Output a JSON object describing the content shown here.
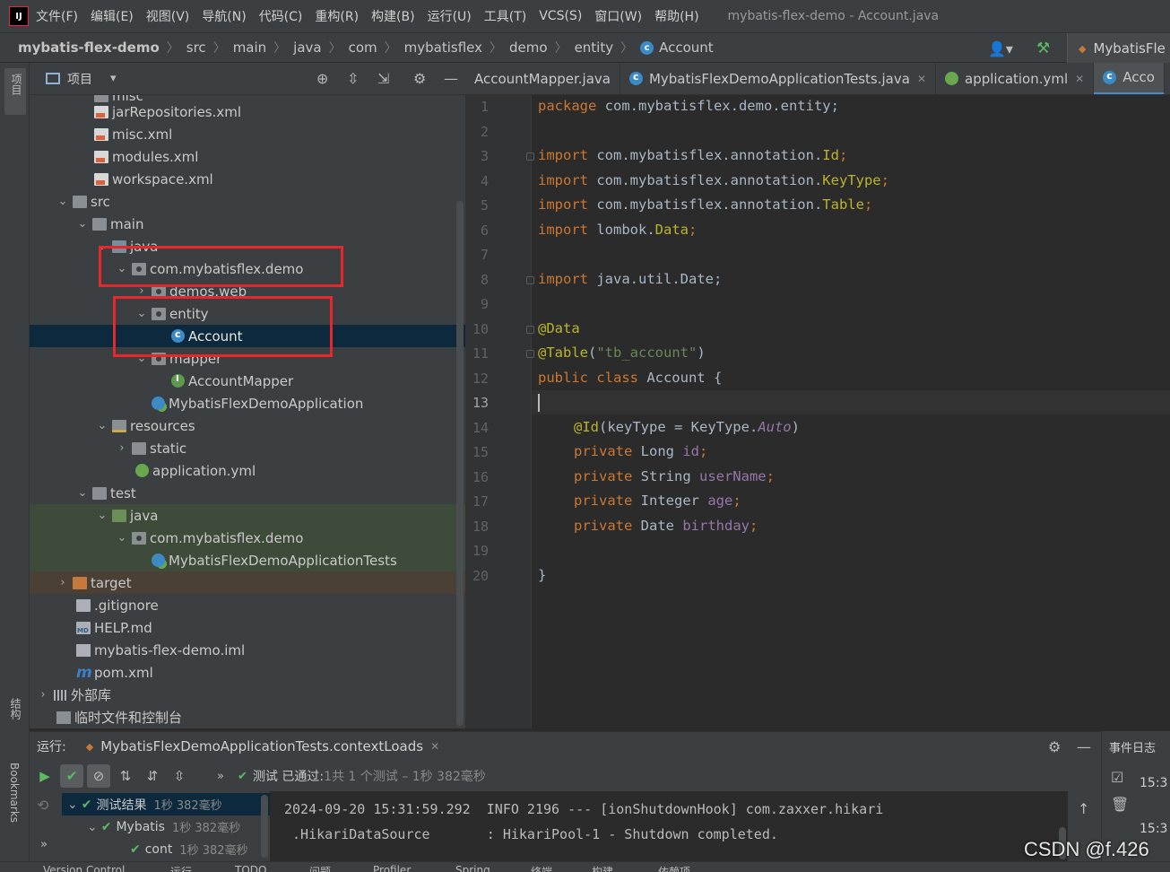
{
  "app": {
    "menu": [
      "文件(F)",
      "编辑(E)",
      "视图(V)",
      "导航(N)",
      "代码(C)",
      "重构(R)",
      "构建(B)",
      "运行(U)",
      "工具(T)",
      "VCS(S)",
      "窗口(W)",
      "帮助(H)"
    ],
    "window_title": "mybatis-flex-demo - Account.java",
    "logo": "IJ"
  },
  "breadcrumb": [
    "mybatis-flex-demo",
    "src",
    "main",
    "java",
    "com",
    "mybatisflex",
    "demo",
    "entity",
    "Account"
  ],
  "run_config": "MybatisFle",
  "project_panel": {
    "title": "项目",
    "strip_label": "项目"
  },
  "tree": [
    {
      "label": "misc",
      "icon": "folder"
    },
    {
      "label": "jarRepositories.xml",
      "icon": "xml"
    },
    {
      "label": "misc.xml",
      "icon": "xml"
    },
    {
      "label": "modules.xml",
      "icon": "xml"
    },
    {
      "label": "workspace.xml",
      "icon": "xml"
    },
    {
      "label": "src",
      "icon": "folder"
    },
    {
      "label": "main",
      "icon": "folder"
    },
    {
      "label": "java",
      "icon": "folder"
    },
    {
      "label": "com.mybatisflex.demo",
      "icon": "pkg"
    },
    {
      "label": "demos.web",
      "icon": "pkg"
    },
    {
      "label": "entity",
      "icon": "pkg"
    },
    {
      "label": "Account",
      "icon": "cls"
    },
    {
      "label": "mapper",
      "icon": "pkg"
    },
    {
      "label": "AccountMapper",
      "icon": "intf"
    },
    {
      "label": "MybatisFlexDemoApplication",
      "icon": "spring"
    },
    {
      "label": "resources",
      "icon": "res"
    },
    {
      "label": "static",
      "icon": "folder"
    },
    {
      "label": "application.yml",
      "icon": "yml"
    },
    {
      "label": "test",
      "icon": "folder"
    },
    {
      "label": "java",
      "icon": "green"
    },
    {
      "label": "com.mybatisflex.demo",
      "icon": "pkg"
    },
    {
      "label": "MybatisFlexDemoApplicationTests",
      "icon": "spring"
    },
    {
      "label": "target",
      "icon": "orange"
    },
    {
      "label": ".gitignore",
      "icon": "file"
    },
    {
      "label": "HELP.md",
      "icon": "md"
    },
    {
      "label": "mybatis-flex-demo.iml",
      "icon": "iml"
    },
    {
      "label": "pom.xml",
      "icon": "pom"
    },
    {
      "label": "外部库",
      "icon": "lib"
    },
    {
      "label": "临时文件和控制台",
      "icon": "scratch"
    }
  ],
  "tabs": [
    {
      "label": "AccountMapper.java",
      "icon": "none"
    },
    {
      "label": "MybatisFlexDemoApplicationTests.java",
      "icon": "cls"
    },
    {
      "label": "application.yml",
      "icon": "yml"
    },
    {
      "label": "Acco",
      "icon": "cls"
    }
  ],
  "editor": {
    "line_numbers": [
      "1",
      "2",
      "3",
      "4",
      "5",
      "6",
      "7",
      "8",
      "9",
      "10",
      "11",
      "12",
      "13",
      "14",
      "15",
      "16",
      "17",
      "18",
      "19",
      "20"
    ],
    "current_line": "13",
    "code": {
      "l1": [
        "package",
        " com.mybatisflex.demo.entity;"
      ],
      "l3": [
        "import",
        " com.mybatisflex.annotation.",
        "Id",
        ";"
      ],
      "l4": [
        "import",
        " com.mybatisflex.annotation.",
        "KeyType",
        ";"
      ],
      "l5": [
        "import",
        " com.mybatisflex.annotation.",
        "Table",
        ";"
      ],
      "l6": [
        "import",
        " lombok.",
        "Data",
        ";"
      ],
      "l8": [
        "import",
        " java.util.Date;"
      ],
      "l10": [
        "@Data"
      ],
      "l11": [
        "@Table",
        "(",
        "\"tb_account\"",
        ")"
      ],
      "l12": [
        "public class",
        " Account {"
      ],
      "l14": [
        "@Id",
        "(keyType = KeyType.",
        "Auto",
        ")"
      ],
      "l15": [
        "private",
        " Long ",
        "id",
        ";"
      ],
      "l16": [
        "private",
        " String ",
        "userName",
        ";"
      ],
      "l17": [
        "private",
        " Integer ",
        "age",
        ";"
      ],
      "l18": [
        "private",
        " Date ",
        "birthday",
        ";"
      ],
      "l20": [
        "}"
      ]
    }
  },
  "run_panel": {
    "title": "运行:",
    "tab": "MybatisFlexDemoApplicationTests.contextLoads",
    "status_prefix": "测试 已通过:",
    "status_detail": " 1共 1 个测试 – 1秒 382毫秒",
    "results": [
      {
        "label": "测试结果",
        "time": "1秒 382毫秒"
      },
      {
        "label": "Mybatis",
        "time": "1秒 382毫秒"
      },
      {
        "label": "cont",
        "time": "1秒 382毫秒"
      }
    ],
    "console_lines": [
      "2024-09-20 15:31:59.292  INFO 2196 --- [ionShutdownHook] com.zaxxer.hikari",
      " .HikariDataSource       : HikariPool-1 - Shutdown completed."
    ]
  },
  "event_log": {
    "title": "事件日志",
    "times": [
      "15:3",
      "15:3"
    ]
  },
  "side_labels": {
    "structure": "结构",
    "bookmarks": "Bookmarks"
  },
  "statusbar": [
    "Version Control",
    "运行",
    "TODO",
    "问题",
    "Profiler",
    "Spring",
    "终端",
    "构建",
    "依赖项"
  ],
  "watermark": "CSDN @f.426"
}
